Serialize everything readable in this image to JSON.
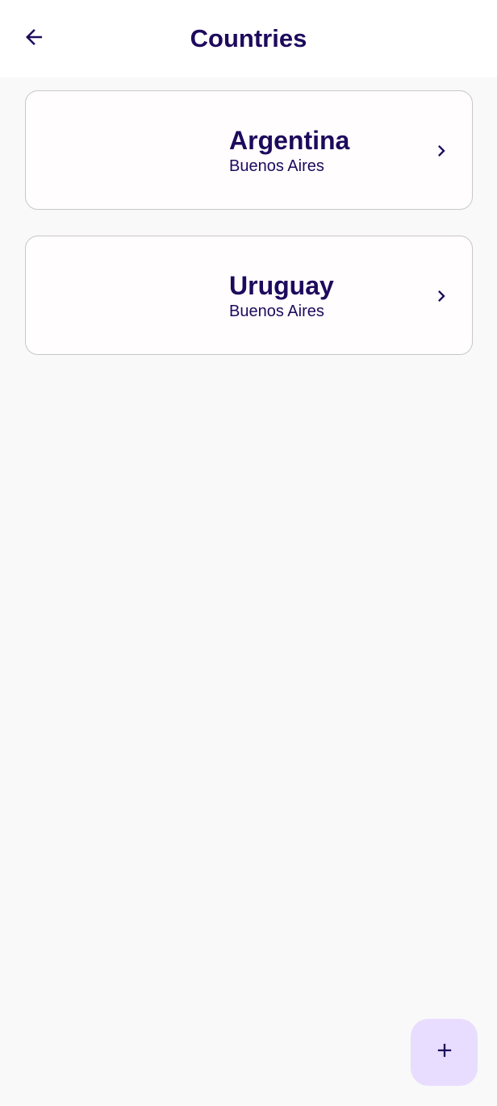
{
  "header": {
    "title": "Countries",
    "back_icon": "arrow-left-icon"
  },
  "countries": [
    {
      "name": "Argentina",
      "capital": "Buenos Aires"
    },
    {
      "name": "Uruguay",
      "capital": "Buenos Aires"
    }
  ],
  "fab": {
    "icon": "plus-icon"
  },
  "colors": {
    "primary_text": "#1d0a5c",
    "fab_background": "#e9ddff",
    "background": "#f8f9f8",
    "card_border": "#c8c6ca"
  }
}
